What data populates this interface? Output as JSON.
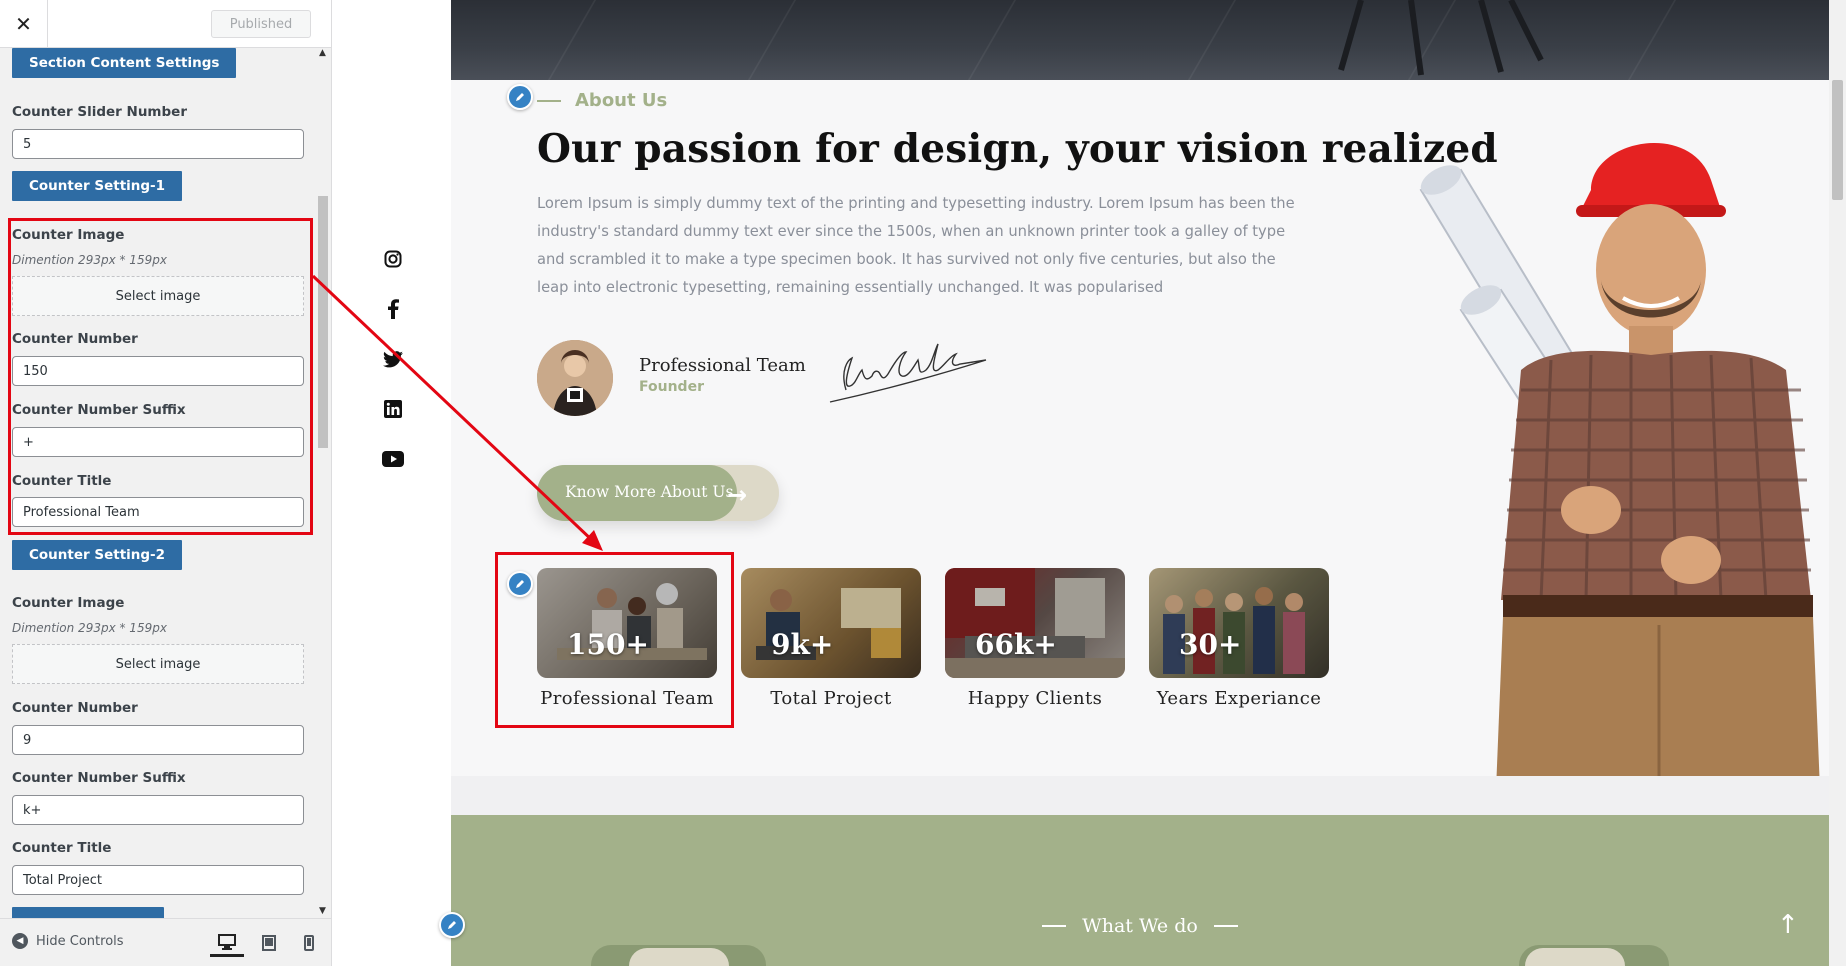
{
  "sidebar": {
    "close_icon": "close-icon",
    "publish_label": "Published",
    "section_content_settings": "Section Content Settings",
    "counter_slider_number_label": "Counter Slider Number",
    "counter_slider_number_value": "5",
    "counter_setting_1": {
      "heading": "Counter Setting-1",
      "image_label": "Counter Image",
      "image_desc": "Dimention 293px * 159px",
      "select_image": "Select image",
      "number_label": "Counter Number",
      "number_value": "150",
      "suffix_label": "Counter Number Suffix",
      "suffix_value": "+",
      "title_label": "Counter Title",
      "title_value": "Professional Team"
    },
    "counter_setting_2": {
      "heading": "Counter Setting-2",
      "image_label": "Counter Image",
      "image_desc": "Dimention 293px * 159px",
      "select_image": "Select image",
      "number_label": "Counter Number",
      "number_value": "9",
      "suffix_label": "Counter Number Suffix",
      "suffix_value": "k+",
      "title_label": "Counter Title",
      "title_value": "Total Project"
    },
    "footer": {
      "hide_controls": "Hide Controls"
    }
  },
  "preview": {
    "social_icons": [
      "instagram-icon",
      "facebook-icon",
      "twitter-icon",
      "linkedin-icon",
      "youtube-icon"
    ],
    "about_label": "About Us",
    "title": "Our passion for design, your vision realized",
    "body": "Lorem Ipsum is simply dummy text of the printing and typesetting industry. Lorem Ipsum has been the industry's standard dummy text ever since the 1500s, when an unknown printer took a galley of type and scrambled it to make a type specimen book. It has survived not only five centuries, but also the leap into electronic typesetting, remaining essentially unchanged. It was popularised",
    "team_name": "Professional Team",
    "team_role": "Founder",
    "cta_label": "Know More About Us",
    "counters": [
      {
        "number": "150+",
        "title": "Professional Team"
      },
      {
        "number": "9k+",
        "title": "Total Project"
      },
      {
        "number": "66k+",
        "title": "Happy Clients"
      },
      {
        "number": "30+",
        "title": "Years Experiance"
      }
    ],
    "what_we_do": "What We do"
  },
  "colors": {
    "accent_green": "#a3b18a",
    "wp_blue": "#2e6ca4",
    "highlight_red": "#e30613"
  }
}
